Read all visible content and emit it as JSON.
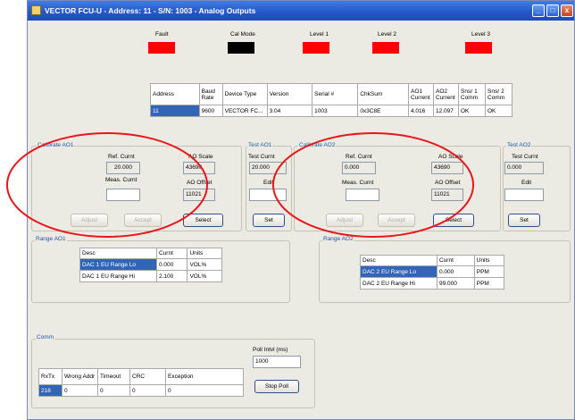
{
  "window": {
    "title": "VECTOR FCU-U - Address: 11 - S/N: 1003 - Analog Outputs",
    "controls": [
      "_",
      "□",
      "x"
    ]
  },
  "indicators": [
    {
      "label": "Fault",
      "color": "#ff0000"
    },
    {
      "label": "Cal Mode",
      "color": "#000000"
    },
    {
      "label": "Level 1",
      "color": "#ff0000"
    },
    {
      "label": "Level 2",
      "color": "#ff0000"
    },
    {
      "label": "Level 3",
      "color": "#ff0000"
    }
  ],
  "device_table": {
    "headers": [
      "Address",
      "Baud Rate",
      "Device Type",
      "Version",
      "Serial #",
      "ChkSum",
      "AO1 Current",
      "AO2 Current",
      "Snsr 1 Comm",
      "Snsr 2 Comm"
    ],
    "row": [
      "11",
      "9600",
      "VECTOR FC...",
      "3.04",
      "1003",
      "0x3C8E",
      "4.016",
      "12.097",
      "OK",
      "OK"
    ]
  },
  "calibrate_ao1": {
    "title": "Calibrate AO1",
    "ref_curr_label": "Ref. Curnt",
    "ref_curr_value": "20.000",
    "meas_curr_label": "Meas. Curnt",
    "meas_curr_value": "",
    "ao_scale_label": "AO Scale",
    "ao_scale_value": "43690",
    "ao_offset_label": "AO Offset",
    "ao_offset_value": "11021",
    "adjust_label": "Adjust",
    "accept_label": "Accept",
    "select_label": "Select"
  },
  "test_ao1": {
    "title": "Test AO1",
    "test_curr_label": "Test Curnt",
    "test_curr_value": "20.000",
    "edit_label": "Edit",
    "edit_value": "",
    "set_label": "Set"
  },
  "calibrate_ao2": {
    "title": "Calibrate AO2",
    "ref_curr_label": "Ref. Curnt",
    "ref_curr_value": "0.000",
    "meas_curr_label": "Meas. Curnt",
    "meas_curr_value": "",
    "ao_scale_label": "AO Scale",
    "ao_scale_value": "43690",
    "ao_offset_label": "AO Offset",
    "ao_offset_value": "11021",
    "adjust_label": "Adjust",
    "accept_label": "Accept",
    "select_label": "Select"
  },
  "test_ao2": {
    "title": "Test AO2",
    "test_curr_label": "Test Curnt",
    "test_curr_value": "0.000",
    "edit_label": "Edit",
    "edit_value": "",
    "set_label": "Set"
  },
  "range_ao1": {
    "title": "Range AO1",
    "headers": [
      "Desc",
      "Curnt",
      "Units"
    ],
    "rows": [
      [
        "DAC 1 EU Range Lo",
        "0.000",
        "VOL%"
      ],
      [
        "DAC 1 EU Range Hi",
        "2.100",
        "VOL%"
      ]
    ]
  },
  "range_ao2": {
    "title": "Range AO2",
    "headers": [
      "Desc",
      "Curnt",
      "Units"
    ],
    "rows": [
      [
        "DAC 2 EU Range Lo",
        "0.000",
        "PPM"
      ],
      [
        "DAC 2 EU Range Hi",
        "99.000",
        "PPM"
      ]
    ]
  },
  "comm": {
    "title": "Comm",
    "headers": [
      "RxTx",
      "Wrong Addr",
      "Timeout",
      "CRC",
      "Exception"
    ],
    "row": [
      "218",
      "0",
      "0",
      "0",
      "0"
    ],
    "poll_label": "Poll Intvl (ms)",
    "poll_value": "1000",
    "stop_poll_label": "Stop Poll"
  },
  "annotation_color": "#e8161b"
}
